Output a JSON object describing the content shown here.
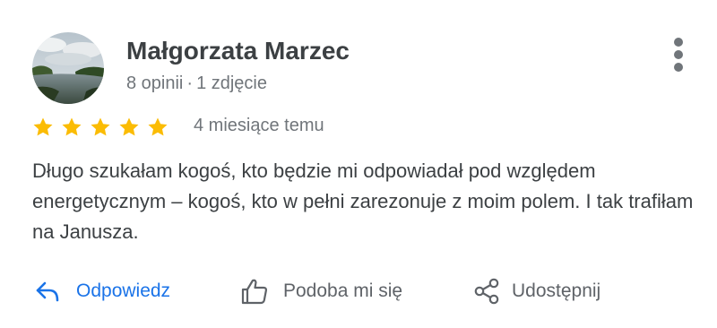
{
  "review": {
    "author": {
      "name": "Małgorzata Marzec",
      "reviews_count": "8 opinii",
      "separator": "·",
      "photos_count": "1 zdjęcie"
    },
    "rating": 5,
    "rating_max": 5,
    "date": "4 miesiące temu",
    "text": "Długo szukałam kogoś, kto będzie mi odpowiadał pod względem energetycznym – kogoś, kto w pełni zarezonuje z moim polem. I tak trafiłam na Janusza."
  },
  "actions": {
    "reply": {
      "label": "Odpowiedz",
      "icon": "reply-icon"
    },
    "like": {
      "label": "Podoba mi się",
      "icon": "thumbs-up-icon"
    },
    "share": {
      "label": "Udostępnij",
      "icon": "share-icon"
    }
  },
  "menu": {
    "icon": "more-vertical-icon"
  },
  "colors": {
    "star": "#fbbc04",
    "link": "#1a73e8",
    "text": "#3c4043",
    "secondary": "#70757a"
  }
}
